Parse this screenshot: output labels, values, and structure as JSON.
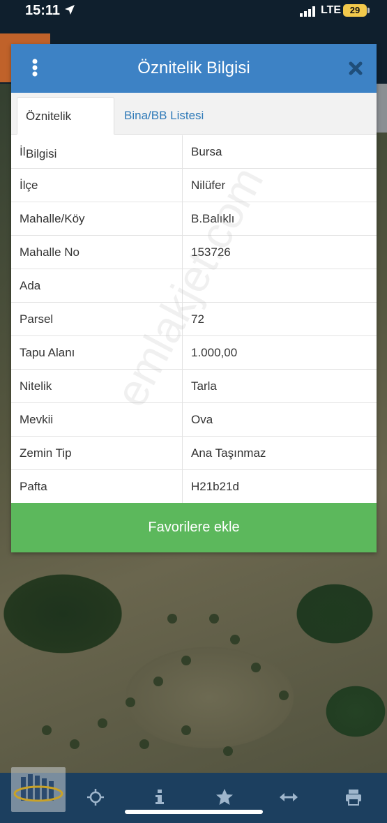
{
  "status_bar": {
    "time": "15:11",
    "network": "LTE",
    "battery": "29"
  },
  "dialog": {
    "title": "Öznitelik Bilgisi",
    "tabs": [
      {
        "label": "Öznitelik Bilgisi",
        "active": true
      },
      {
        "label": "Bina/BB Listesi",
        "active": false
      }
    ],
    "rows": [
      {
        "key": "İl",
        "value": "Bursa"
      },
      {
        "key": "İlçe",
        "value": "Nilüfer"
      },
      {
        "key": "Mahalle/Köy",
        "value": "B.Balıklı"
      },
      {
        "key": "Mahalle No",
        "value": "153726"
      },
      {
        "key": "Ada",
        "value": ""
      },
      {
        "key": "Parsel",
        "value": "72"
      },
      {
        "key": "Tapu Alanı",
        "value": "1.000,00"
      },
      {
        "key": "Nitelik",
        "value": "Tarla"
      },
      {
        "key": "Mevkii",
        "value": "Ova"
      },
      {
        "key": "Zemin Tip",
        "value": "Ana Taşınmaz"
      },
      {
        "key": "Pafta",
        "value": "H21b21d"
      }
    ],
    "favorite_button": "Favorilere ekle"
  },
  "watermark": "emlakjet.com",
  "toolbar": {
    "icons": [
      "crosshair-icon",
      "info-icon",
      "star-icon",
      "measure-icon",
      "print-icon"
    ]
  },
  "colors": {
    "header": "#3d82c5",
    "favorite": "#5cb85c",
    "toolbar": "#1c3f5f",
    "tab_link": "#2f7ab8"
  }
}
